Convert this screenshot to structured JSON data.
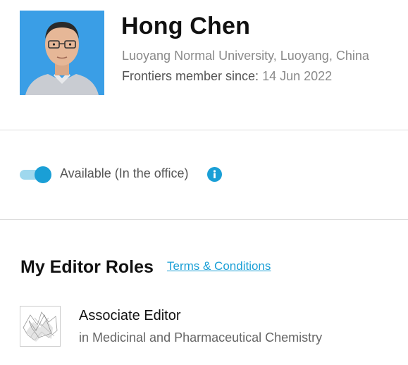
{
  "profile": {
    "name": "Hong Chen",
    "affiliation": "Luoyang Normal University, Luoyang, China",
    "member_since_label": "Frontiers member since:",
    "member_since_date": "14 Jun 2022",
    "avatar_icon": "profile-photo"
  },
  "availability": {
    "enabled": true,
    "label": "Available (In the office)",
    "info_icon": "info-icon",
    "colors": {
      "accent": "#1a9fd6",
      "track": "#9fd8ee"
    }
  },
  "editor_roles": {
    "heading": "My Editor Roles",
    "terms_link": "Terms & Conditions",
    "roles": [
      {
        "title": "Associate Editor",
        "journal": "in Medicinal and Pharmaceutical Chemistry",
        "thumbnail_icon": "journal-thumbnail"
      }
    ]
  }
}
